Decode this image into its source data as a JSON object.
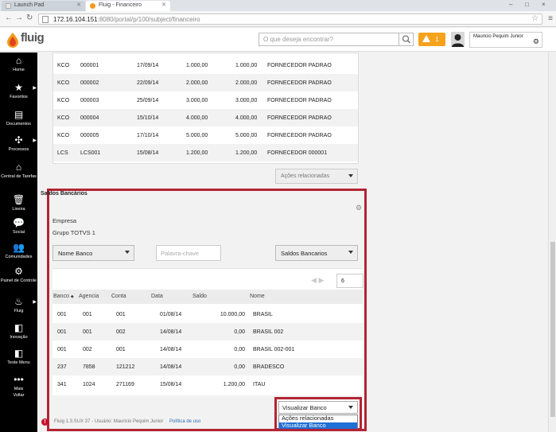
{
  "browser": {
    "tabs": [
      {
        "label": "Launch Pad"
      },
      {
        "label": "Fluig - Financeiro"
      }
    ],
    "url_host": "172.16.104.151",
    "url_path": ":8080/portal/p/100/subject/financeiro",
    "min": "–",
    "max": "□",
    "close": "×"
  },
  "header": {
    "logo_text": "fluig",
    "search_placeholder": "O que deseja encontrar?",
    "alert_count": "1",
    "user_name": "Mauricio Pequim Junior"
  },
  "sidebar": {
    "items": [
      {
        "label": "Home",
        "icon": "home-icon"
      },
      {
        "label": "Favoritos",
        "icon": "star-icon"
      },
      {
        "label": "Documentos",
        "icon": "documents-icon"
      },
      {
        "label": "Processos",
        "icon": "processes-icon"
      },
      {
        "label": "Central de Tarefas",
        "icon": "tasks-icon"
      },
      {
        "label": "Lixeira",
        "icon": "trash-icon"
      },
      {
        "label": "Social",
        "icon": "social-icon"
      },
      {
        "label": "Comunidades",
        "icon": "communities-icon"
      },
      {
        "label": "Painel de Controle",
        "icon": "control-panel-icon"
      },
      {
        "label": "Fluig",
        "icon": "fluig-icon"
      },
      {
        "label": "Inovação",
        "icon": "innovation-icon"
      },
      {
        "label": "Teste Menu",
        "icon": "test-menu-icon"
      },
      {
        "label": "Mais",
        "icon": "more-icon"
      },
      {
        "label": "Voltar",
        "icon": ""
      }
    ]
  },
  "top_table": {
    "rows": [
      [
        "KCO",
        "000001",
        "17/09/14",
        "1.000,00",
        "1.000,00",
        "FORNECEDOR PADRAO"
      ],
      [
        "KCO",
        "000002",
        "22/09/14",
        "2.000,00",
        "2.000,00",
        "FORNECEDOR PADRAO"
      ],
      [
        "KCO",
        "000003",
        "25/09/14",
        "3.000,00",
        "3.000,00",
        "FORNECEDOR PADRAO"
      ],
      [
        "KCO",
        "000004",
        "15/10/14",
        "4.000,00",
        "4.000,00",
        "FORNECEDOR PADRAO"
      ],
      [
        "KCO",
        "000005",
        "17/10/14",
        "5.000,00",
        "5.000,00",
        "FORNECEDOR PADRAO"
      ],
      [
        "LCS",
        "LCS001",
        "15/08/14",
        "1.200,00",
        "1.200,00",
        "FORNECEDOR 000001"
      ]
    ],
    "actions_label": "Ações relacionadas"
  },
  "saldos": {
    "title": "Saldos Bancários",
    "empresa_label": "Empresa",
    "grupo_label": "Grupo TOTVS 1",
    "filter_field": "Nome Banco",
    "keyword_placeholder": "Palavra-chave",
    "view_select": "Saldos Bancarios",
    "page_size": "6",
    "columns": [
      "Banco",
      "Agencia",
      "Conta",
      "Data",
      "Saldo",
      "Nome"
    ],
    "rows": [
      [
        "001",
        "001",
        "001",
        "01/08/14",
        "10.000,00",
        "BRASIL"
      ],
      [
        "001",
        "001",
        "002",
        "14/08/14",
        "0,00",
        "BRASIL 002"
      ],
      [
        "001",
        "002",
        "001",
        "14/08/14",
        "0,00",
        "BRASIL 002-001"
      ],
      [
        "237",
        "7858",
        "121212",
        "14/08/14",
        "0,00",
        "BRADESCO"
      ],
      [
        "341",
        "1024",
        "271169",
        "15/08/14",
        "1.200,00",
        "ITAU"
      ]
    ],
    "dropdown": {
      "selected": "Visualizar Banco",
      "options": [
        "Ações relacionadas",
        "Visualizar Banco"
      ]
    }
  },
  "footer": {
    "text": "Fluig 1.3.SUX 37 - Usuário: Mauricio Pequim Junior",
    "link": "Política de uso"
  },
  "colors": {
    "highlight_border": "#b32433",
    "alert": "#f5a21d",
    "sidebar": "#000000",
    "selected_option": "#1e6fd6"
  }
}
